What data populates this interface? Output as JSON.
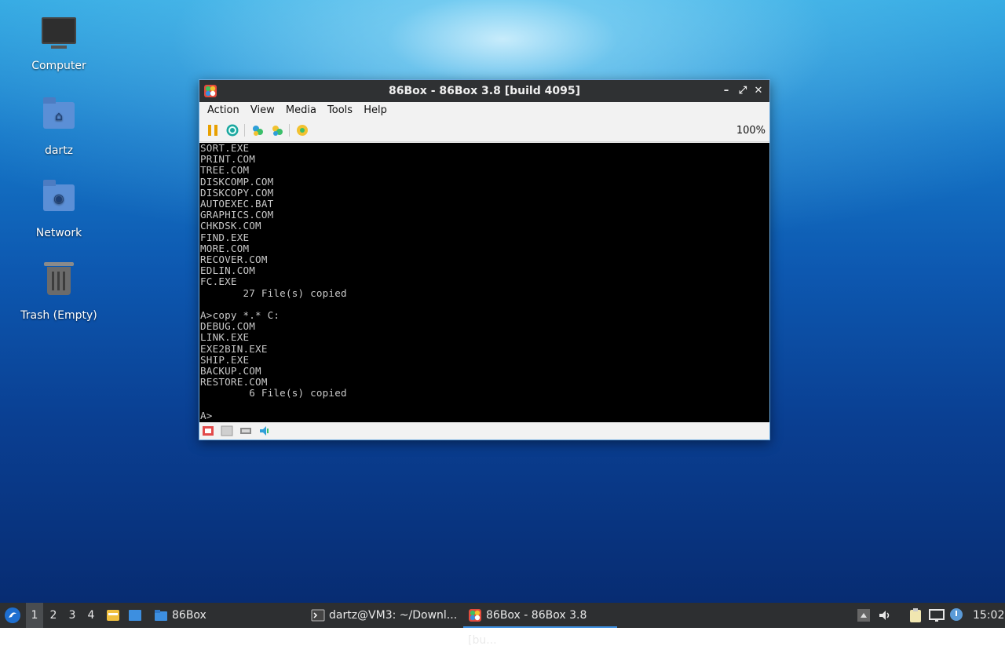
{
  "desktop": {
    "icons": [
      {
        "label": "Computer",
        "icon": "computer-icon"
      },
      {
        "label": "dartz",
        "icon": "home-folder-icon"
      },
      {
        "label": "Network",
        "icon": "network-folder-icon"
      },
      {
        "label": "Trash (Empty)",
        "icon": "trash-icon"
      }
    ]
  },
  "window": {
    "title": "86Box - 86Box 3.8 [build 4095]",
    "controls": {
      "minimize": "–",
      "maximize": "⤢",
      "close": "✕"
    },
    "menu": [
      "Action",
      "View",
      "Media",
      "Tools",
      "Help"
    ],
    "zoom": "100%",
    "screen_lines": [
      "SORT.EXE",
      "PRINT.COM",
      "TREE.COM",
      "DISKCOMP.COM",
      "DISKCOPY.COM",
      "AUTOEXEC.BAT",
      "GRAPHICS.COM",
      "CHKDSK.COM",
      "FIND.EXE",
      "MORE.COM",
      "RECOVER.COM",
      "EDLIN.COM",
      "FC.EXE",
      "       27 File(s) copied",
      "",
      "A>copy *.* C:",
      "DEBUG.COM",
      "LINK.EXE",
      "EXE2BIN.EXE",
      "SHIP.EXE",
      "BACKUP.COM",
      "RESTORE.COM",
      "        6 File(s) copied",
      "",
      "A>"
    ]
  },
  "taskbar": {
    "workspaces": [
      "1",
      "2",
      "3",
      "4"
    ],
    "folder_task": "86Box",
    "tasks": [
      {
        "label": "dartz@VM3: ~/Downl...",
        "icon": "terminal-icon"
      },
      {
        "label": "86Box - 86Box 3.8 [bu...",
        "icon": "86box-icon"
      }
    ],
    "clock": "15:02"
  },
  "colors": {
    "titlebar": "#2f3133",
    "taskbar": "#2d2f31",
    "active_task_underline": "#3d8fe0",
    "screen_text": "#c8c8c8"
  }
}
